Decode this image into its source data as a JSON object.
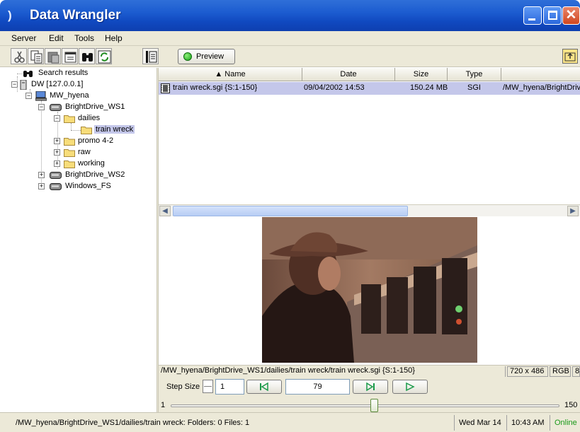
{
  "window": {
    "title": "Data Wrangler"
  },
  "menu": [
    "Server",
    "Edit",
    "Tools",
    "Help"
  ],
  "toolbar": {
    "preview_label": "Preview"
  },
  "tree": {
    "search": "Search results",
    "server": "DW [127.0.0.1]",
    "host": "MW_hyena",
    "ws1": "BrightDrive_WS1",
    "dailies": "dailies",
    "train_wreck": "train wreck",
    "promo": "promo 4-2",
    "raw": "raw",
    "working": "working",
    "ws2": "BrightDrive_WS2",
    "fs": "Windows_FS"
  },
  "table": {
    "columns": [
      "Name",
      "Date",
      "Size",
      "Type",
      ""
    ],
    "rows": [
      {
        "name": "train wreck.sgi {S:1-150}",
        "date": "09/04/2002 14:53",
        "size": "150.24 MB",
        "type": "SGI",
        "path": "/MW_hyena/BrightDrive"
      }
    ]
  },
  "preview": {
    "path": "/MW_hyena/BrightDrive_WS1/dailies/train wreck/train wreck.sgi {S:1-150}",
    "resolution": "720 x 486",
    "color": "RGB",
    "depth": "8"
  },
  "controls": {
    "step_label": "Step Size",
    "step_value": "1",
    "frame": "79",
    "slider_min": "1",
    "slider_max": "150",
    "slider_fraction": 0.523
  },
  "status": {
    "path": "/MW_hyena/BrightDrive_WS1/dailies/train wreck: Folders: 0 Files: 1",
    "date": "Wed Mar 14",
    "time": "10:43 AM",
    "state": "Online"
  }
}
